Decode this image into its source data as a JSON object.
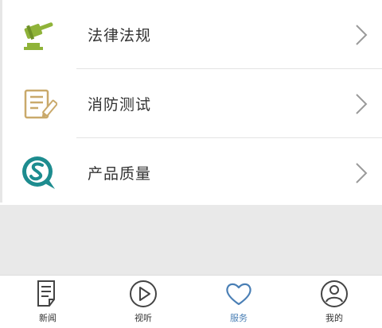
{
  "list": {
    "items": [
      {
        "label": "法律法规",
        "icon": "gavel-icon"
      },
      {
        "label": "消防测试",
        "icon": "test-form-icon"
      },
      {
        "label": "产品质量",
        "icon": "quality-s-icon"
      }
    ]
  },
  "tabbar": {
    "tabs": [
      {
        "label": "新闻",
        "icon": "news-icon",
        "active": false
      },
      {
        "label": "视听",
        "icon": "play-icon",
        "active": false
      },
      {
        "label": "服务",
        "icon": "heart-icon",
        "active": true
      },
      {
        "label": "我的",
        "icon": "profile-icon",
        "active": false
      }
    ]
  },
  "colors": {
    "accent": "#4a7fb5",
    "gavel": "#8fb339",
    "test_icon": "#c9a96b",
    "quality_icon": "#1d8c8f"
  }
}
